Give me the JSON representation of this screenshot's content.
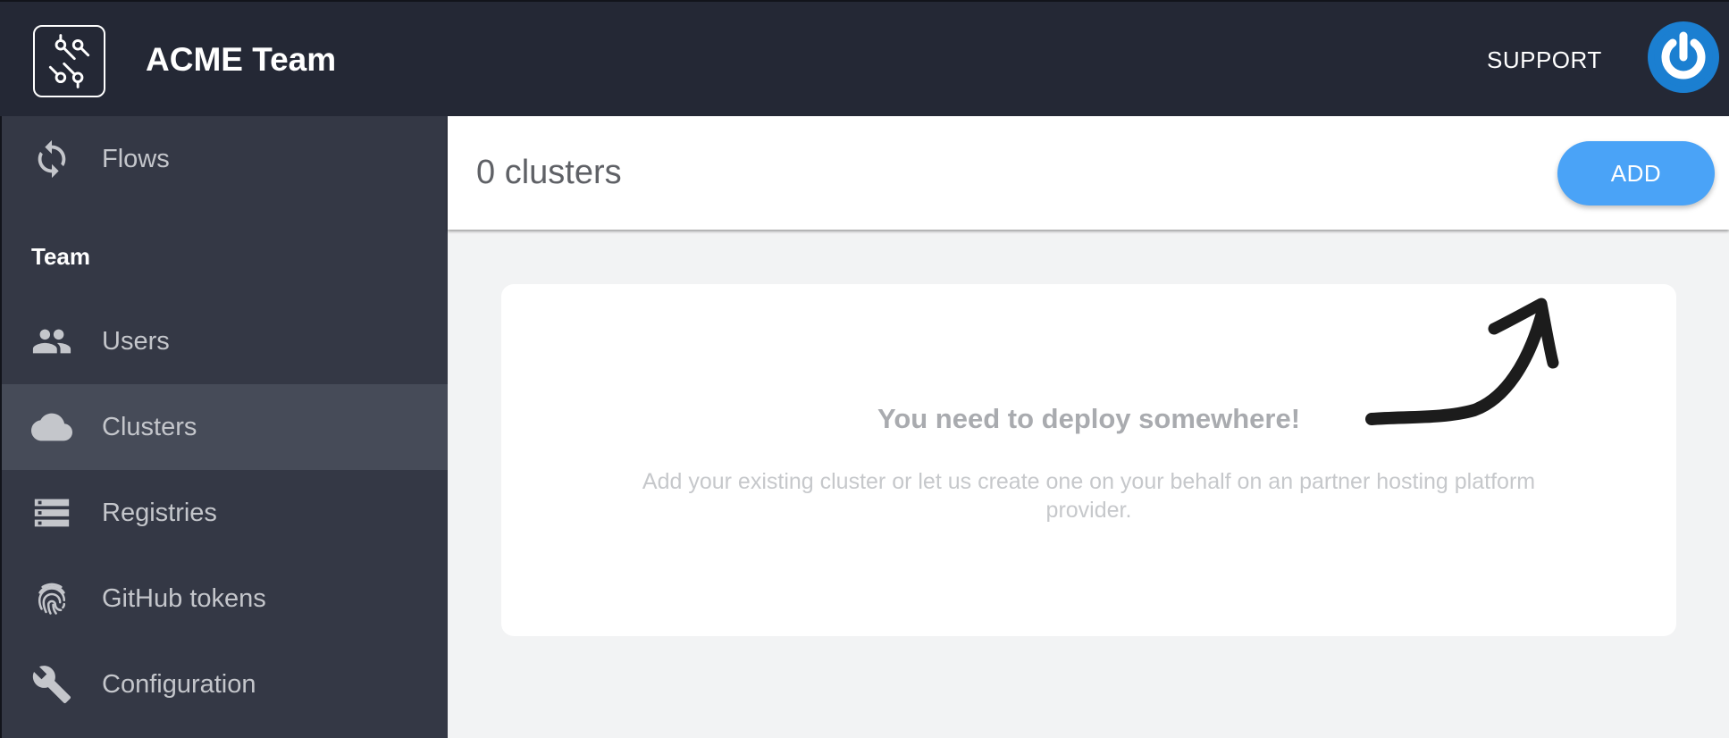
{
  "header": {
    "team_name": "ACME Team",
    "support_label": "SUPPORT",
    "logo_icon": "circuit-icon",
    "avatar_icon": "power-icon"
  },
  "sidebar": {
    "top_items": [
      {
        "label": "Flows",
        "icon": "sync-icon"
      }
    ],
    "section_label": "Team",
    "items": [
      {
        "label": "Users",
        "icon": "people-icon"
      },
      {
        "label": "Clusters",
        "icon": "cloud-icon",
        "active": true
      },
      {
        "label": "Registries",
        "icon": "storage-icon"
      },
      {
        "label": "GitHub tokens",
        "icon": "fingerprint-icon"
      },
      {
        "label": "Configuration",
        "icon": "wrench-icon"
      }
    ]
  },
  "main": {
    "count_label": "0 clusters",
    "add_label": "ADD",
    "empty_state": {
      "title": "You need to deploy somewhere!",
      "description": "Add your existing cluster or let us create one on your behalf on an partner hosting platform provider."
    }
  },
  "colors": {
    "topbar": "#242835",
    "sidebar": "#343845",
    "sidebar_active": "#464b58",
    "accent": "#4aa3f7",
    "avatar": "#1b7fd1",
    "background": "#f2f3f4"
  }
}
